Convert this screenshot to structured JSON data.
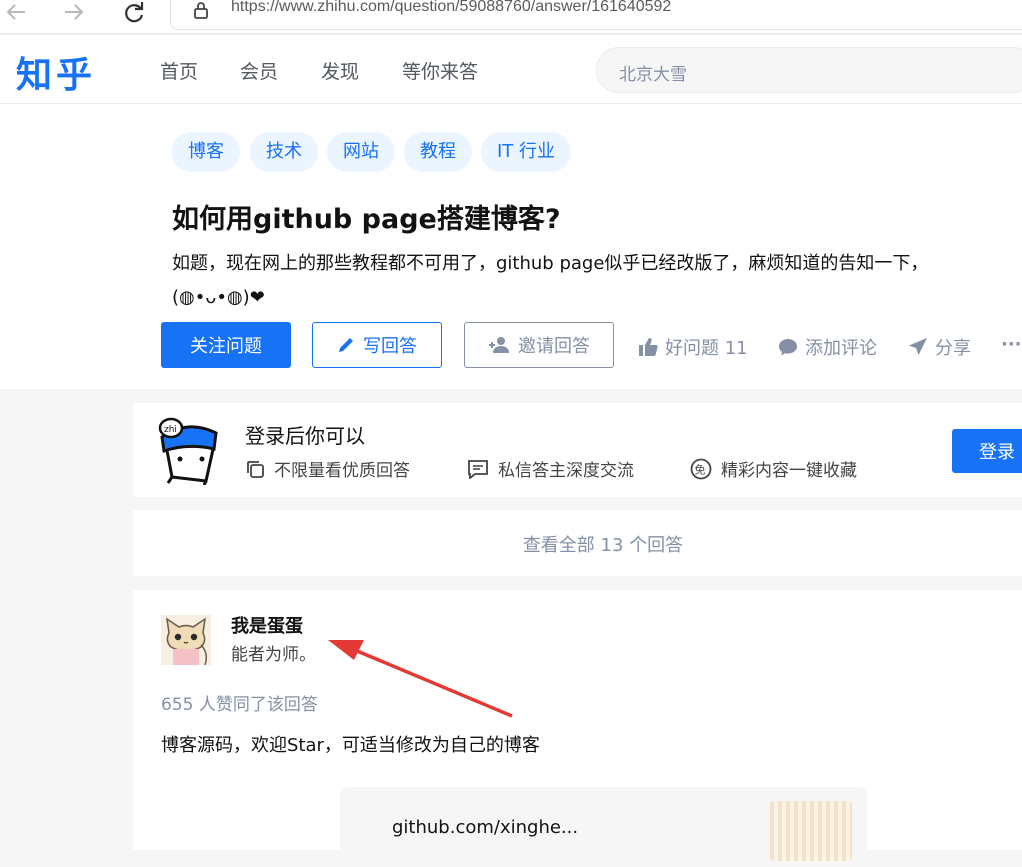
{
  "browser": {
    "url": "https://www.zhihu.com/question/59088760/answer/161640592"
  },
  "header": {
    "logo": "知乎",
    "nav": [
      "首页",
      "会员",
      "发现",
      "等你来答"
    ],
    "search_placeholder": "北京大雪"
  },
  "question": {
    "tags": [
      "博客",
      "技术",
      "网站",
      "教程",
      "IT 行业"
    ],
    "title": "如何用github page搭建博客?",
    "description_line1": "如题，现在网上的那些教程都不可用了，github page似乎已经改版了，麻烦知道的告知一下，",
    "description_line2": "(◍•ᴗ•◍)❤",
    "follow_label": "关注问题",
    "write_label": "写回答",
    "invite_label": "邀请回答",
    "good_question_label": "好问题 11",
    "comment_label": "添加评论",
    "share_label": "分享",
    "more_label": "···"
  },
  "login_prompt": {
    "title": "登录后你可以",
    "features": [
      "不限量看优质回答",
      "私信答主深度交流",
      "精彩内容一键收藏"
    ],
    "login_label": "登录",
    "mascot_text": "zhi"
  },
  "view_all": {
    "label": "查看全部 13 个回答"
  },
  "answer": {
    "author": "我是蛋蛋",
    "bio": "能者为师。",
    "votes": "655 人赞同了该回答",
    "content": "博客源码，欢迎Star，可适当修改为自己的博客",
    "link_partial": "github.com/xinghe..."
  },
  "colors": {
    "brand": "#1772f6",
    "annotation_arrow": "#e53935"
  }
}
